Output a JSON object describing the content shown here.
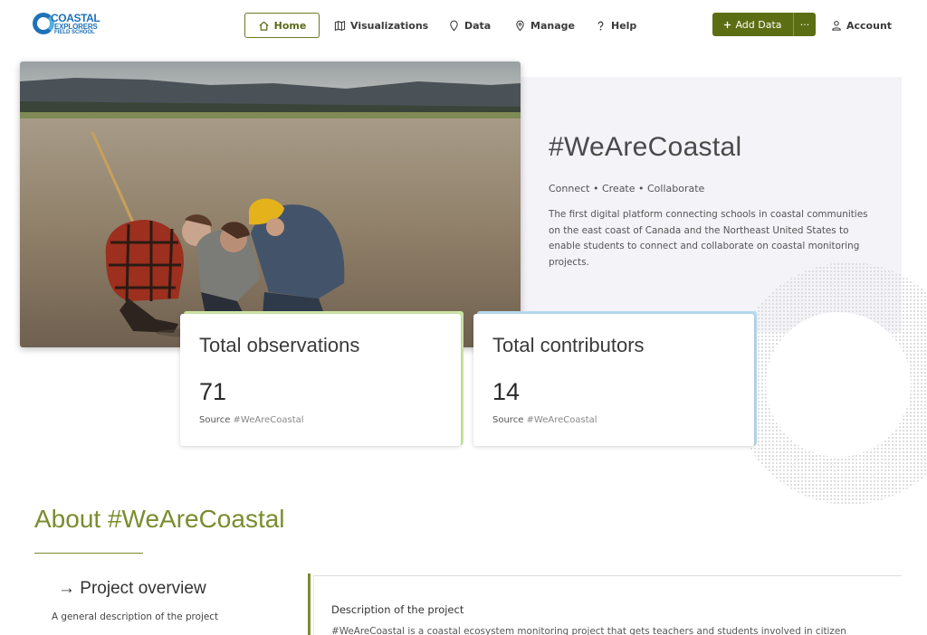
{
  "logo": {
    "line1": "COASTAL",
    "line2": "EXPLORERS",
    "line3": "FIELD SCHOOL"
  },
  "nav": {
    "home": "Home",
    "visualizations": "Visualizations",
    "data": "Data",
    "manage": "Manage",
    "help": "Help",
    "add_data": "Add Data",
    "more": "···",
    "account": "Account"
  },
  "hero": {
    "title": "#WeAreCoastal",
    "tagline": "Connect • Create • Collaborate",
    "description": "The first digital platform connecting schools in coastal communities on the east coast of Canada and the Northeast United States to enable students to connect and collaborate on coastal monitoring projects."
  },
  "stats": [
    {
      "label": "Total observations",
      "value": "71",
      "source_prefix": "Source",
      "source": "#WeAreCoastal",
      "accent": "#cfe8a8"
    },
    {
      "label": "Total contributors",
      "value": "14",
      "source_prefix": "Source",
      "source": "#WeAreCoastal",
      "accent": "#b9dcf0"
    }
  ],
  "about": {
    "title": "About #WeAreCoastal",
    "overview_title": "→ Project overview",
    "overview_sub": "A general description of the project",
    "desc_title": "Description of the project",
    "desc_text": "#WeAreCoastal is a coastal ecosystem monitoring project that gets teachers and students involved in citizen"
  },
  "colors": {
    "accent": "#5c6e13",
    "heading_green": "#7a8c2e",
    "panel_bg": "#f3f3f8"
  }
}
